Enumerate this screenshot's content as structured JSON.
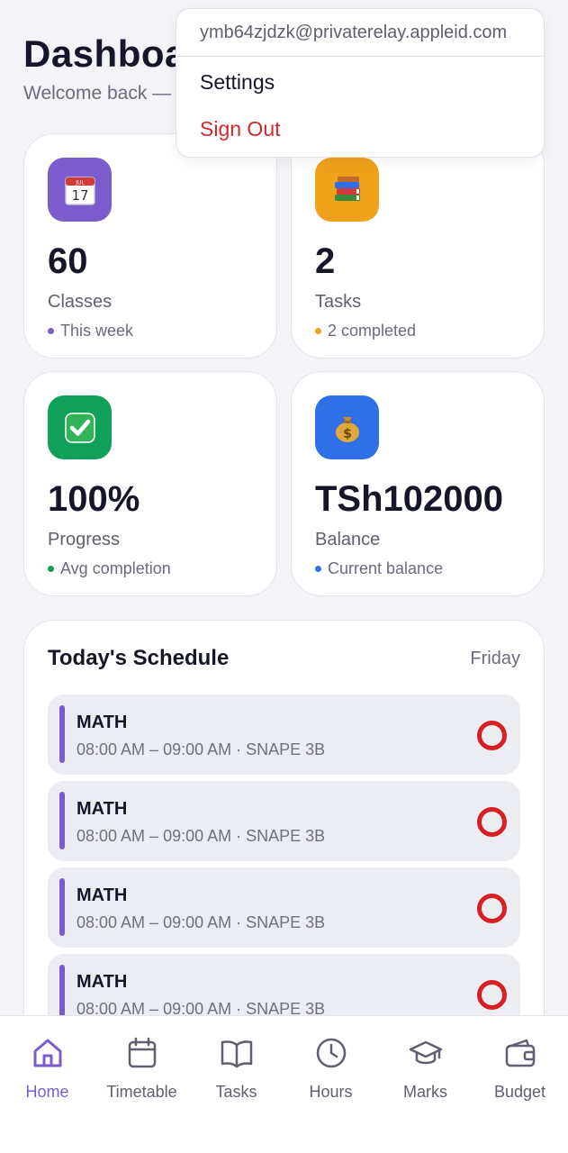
{
  "header": {
    "title": "Dashboard",
    "welcome": "Welcome back — "
  },
  "account_menu": {
    "email": "ymb64zjdzk@privaterelay.appleid.com",
    "settings_label": "Settings",
    "sign_out_label": "Sign Out"
  },
  "stats": [
    {
      "icon": "calendar-icon",
      "icon_bg": "#7b5ccd",
      "value": "60",
      "label": "Classes",
      "sub": "This week",
      "dot_color": "#7b5ccd"
    },
    {
      "icon": "books-icon",
      "icon_bg": "#f0a11a",
      "value": "2",
      "label": "Tasks",
      "sub": "2 completed",
      "dot_color": "#f0a11a"
    },
    {
      "icon": "checkmark-icon",
      "icon_bg": "#10a05a",
      "value": "100%",
      "label": "Progress",
      "sub": "Avg completion",
      "dot_color": "#10a05a"
    },
    {
      "icon": "money-bag-icon",
      "icon_bg": "#2f6fe8",
      "value": "TSh102000",
      "label": "Balance",
      "sub": "Current balance",
      "dot_color": "#2f6fe8"
    }
  ],
  "schedule": {
    "title": "Today's Schedule",
    "day": "Friday",
    "items": [
      {
        "subject": "MATH",
        "meta": "08:00 AM – 09:00 AM · SNAPE 3B"
      },
      {
        "subject": "MATH",
        "meta": "08:00 AM – 09:00 AM · SNAPE 3B"
      },
      {
        "subject": "MATH",
        "meta": "08:00 AM – 09:00 AM · SNAPE 3B"
      },
      {
        "subject": "MATH",
        "meta": "08:00 AM – 09:00 AM · SNAPE 3B"
      }
    ]
  },
  "nav": {
    "active": "Home",
    "items": [
      {
        "label": "Home",
        "icon": "home-icon"
      },
      {
        "label": "Timetable",
        "icon": "calendar-icon"
      },
      {
        "label": "Tasks",
        "icon": "book-icon"
      },
      {
        "label": "Hours",
        "icon": "clock-icon"
      },
      {
        "label": "Marks",
        "icon": "graduation-cap-icon"
      },
      {
        "label": "Budget",
        "icon": "wallet-icon"
      }
    ]
  },
  "colors": {
    "accent": "#7b5ccd",
    "danger": "#d22a2a",
    "status_ring": "#d81f26"
  }
}
